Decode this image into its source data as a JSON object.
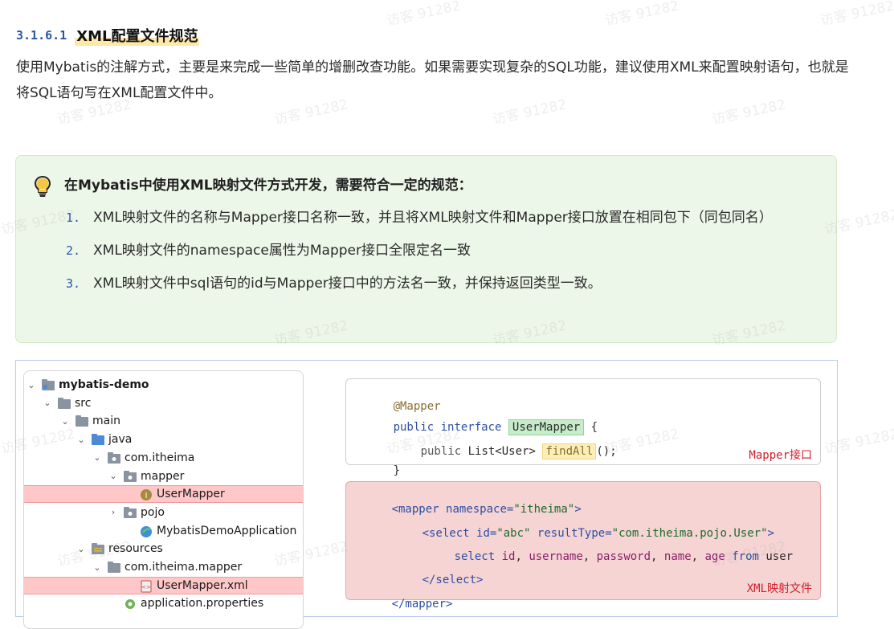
{
  "section": {
    "number": "3.1.6.1",
    "title": "XML配置文件规范"
  },
  "intro": "使用Mybatis的注解方式，主要是来完成一些简单的增删改查功能。如果需要实现复杂的SQL功能，建议使用XML来配置映射语句，也就是将SQL语句写在XML配置文件中。",
  "tip": {
    "title": "在Mybatis中使用XML映射文件方式开发，需要符合一定的规范：",
    "items": [
      {
        "n": "1.",
        "text": "XML映射文件的名称与Mapper接口名称一致，并且将XML映射文件和Mapper接口放置在相同包下（同包同名）"
      },
      {
        "n": "2.",
        "text": "XML映射文件的namespace属性为Mapper接口全限定名一致"
      },
      {
        "n": "3.",
        "text": "XML映射文件中sql语句的id与Mapper接口中的方法名一致，并保持返回类型一致。"
      }
    ]
  },
  "tree": [
    {
      "label": "mybatis-demo",
      "arrow": "⌄",
      "icon": "module-folder-icon",
      "bold": true
    },
    {
      "label": "src",
      "arrow": "⌄",
      "icon": "folder-icon"
    },
    {
      "label": "main",
      "arrow": "⌄",
      "icon": "folder-icon"
    },
    {
      "label": "java",
      "arrow": "⌄",
      "icon": "source-folder-icon"
    },
    {
      "label": "com.itheima",
      "arrow": "⌄",
      "icon": "package-icon"
    },
    {
      "label": "mapper",
      "arrow": "⌄",
      "icon": "package-icon"
    },
    {
      "label": "UserMapper",
      "arrow": "",
      "icon": "interface-icon",
      "highlight": true
    },
    {
      "label": "pojo",
      "arrow": "›",
      "icon": "package-icon"
    },
    {
      "label": "MybatisDemoApplication",
      "arrow": "",
      "icon": "spring-class-icon"
    },
    {
      "label": "resources",
      "arrow": "⌄",
      "icon": "resources-folder-icon"
    },
    {
      "label": "com.itheima.mapper",
      "arrow": "⌄",
      "icon": "folder-icon"
    },
    {
      "label": "UserMapper.xml",
      "arrow": "",
      "icon": "xml-file-icon",
      "highlight": true
    },
    {
      "label": "application.properties",
      "arrow": "",
      "icon": "properties-file-icon"
    }
  ],
  "mapper_code": {
    "annotation": "@Mapper",
    "kw_public": "public",
    "kw_interface": "interface",
    "class_name": "UserMapper",
    "brace_open": "{",
    "method_public": "public",
    "return_type": "List<User>",
    "method_name": "findAll",
    "method_tail": "();",
    "brace_close": "}",
    "label": "Mapper接口"
  },
  "xml_code": {
    "l1_tag": "<mapper",
    "l1_attr": "namespace=",
    "l1_val": "\"itheima\"",
    "l1_end": ">",
    "l2_tag": "<select",
    "l2_attr1": "id=",
    "l2_val1": "\"abc\"",
    "l2_attr2": "resultType=",
    "l2_val2": "\"com.itheima.pojo.User\"",
    "l2_end": ">",
    "l3_select": "select",
    "l3_cols": [
      "id",
      "username",
      "password",
      "name",
      "age"
    ],
    "l3_from": "from",
    "l3_table": "user",
    "l4": "</select>",
    "l5": "</mapper>",
    "label": "XML映射文件"
  },
  "watermark": "访客 91282",
  "colors": {
    "accent": "#2b55a6",
    "tip_bg": "#edf7e9",
    "highlight": "#ffc7c7",
    "label_red": "#d0202a"
  }
}
